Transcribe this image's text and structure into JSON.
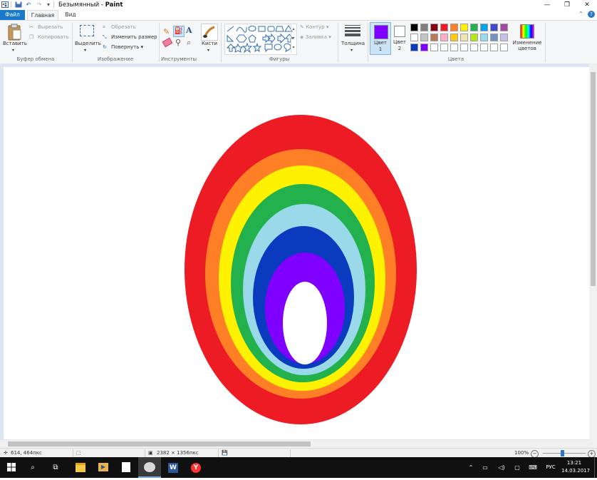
{
  "window": {
    "title": "Безымянный - Paint",
    "title_separator": " - ",
    "title_doc": "Безымянный",
    "title_app": "Paint"
  },
  "tabs": {
    "file": "Файл",
    "home": "Главная",
    "view": "Вид"
  },
  "ribbon": {
    "clipboard": {
      "paste": "Вставить",
      "cut": "Вырезать",
      "copy": "Копировать",
      "group": "Буфер обмена"
    },
    "image": {
      "select": "Выделить",
      "crop": "Обрезать",
      "resize": "Изменить размер",
      "rotate": "Повернуть",
      "group": "Изображение"
    },
    "tools": {
      "group": "Инструменты",
      "text_glyph": "A"
    },
    "brushes": {
      "label": "Кисти"
    },
    "shapes": {
      "outline": "Контур",
      "fill": "Заливка",
      "group": "Фигуры"
    },
    "size": {
      "label": "Толщина"
    },
    "colors": {
      "color1": "Цвет\n1",
      "color1_l1": "Цвет",
      "color1_l2": "1",
      "color2_l1": "Цвет",
      "color2_l2": "2",
      "edit": "Изменение цветов",
      "edit_l1": "Изменение",
      "edit_l2": "цветов",
      "group": "Цвета",
      "color1_value": "#8000ff",
      "color2_value": "#ffffff",
      "palette_row1": [
        "#000000",
        "#7f7f7f",
        "#880015",
        "#ed1c24",
        "#ff7f27",
        "#fff200",
        "#22b14c",
        "#00a2e8",
        "#3f48cc",
        "#a349a4"
      ],
      "palette_row2": [
        "#ffffff",
        "#c3c3c3",
        "#b97a57",
        "#ffaec9",
        "#ffc90e",
        "#efe4b0",
        "#b5e61d",
        "#99d9ea",
        "#7092be",
        "#c8bfe7"
      ],
      "palette_row3": [
        "#0a3bbf",
        "#8000ff",
        "#ffffff",
        "#ffffff",
        "#ffffff",
        "#ffffff",
        "#ffffff",
        "#ffffff",
        "#ffffff",
        "#ffffff"
      ]
    }
  },
  "drawing": {
    "rings": [
      "#ed1c24",
      "#ff7f27",
      "#fff200",
      "#22b14c",
      "#99d9ea",
      "#0a3bbf",
      "#8000ff",
      "#ffffff"
    ]
  },
  "status": {
    "cursor": "614, 464пкс",
    "size": "2382 × 1356пкс",
    "zoom": "100%"
  },
  "taskbar": {
    "lang": "РУС",
    "time": "13:21",
    "date": "14.03.2017"
  }
}
